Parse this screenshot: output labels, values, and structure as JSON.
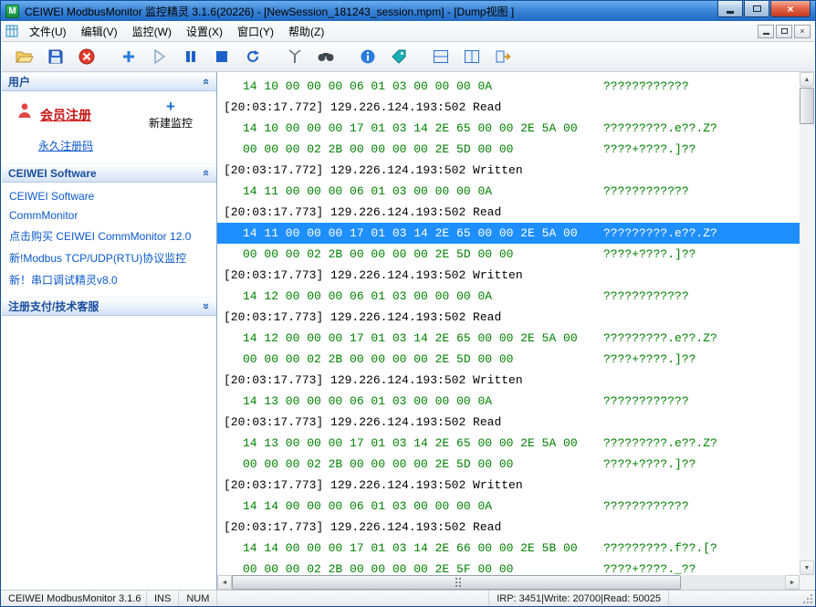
{
  "window": {
    "title": "CEIWEI ModbusMonitor 监控精灵 3.1.6(20226) - [NewSession_181243_session.mpm] - [Dump视图 ]",
    "icon_letter": "M"
  },
  "menu": {
    "items": [
      "文件(U)",
      "编辑(V)",
      "监控(W)",
      "设置(X)",
      "窗口(Y)",
      "帮助(Z)"
    ]
  },
  "toolbar": {
    "icons": [
      "open",
      "save",
      "cancel",
      "new-monitor",
      "start",
      "pause",
      "stop",
      "restart",
      "transmit",
      "find",
      "about",
      "tag",
      "split-horizontal",
      "split-vertical",
      "exit"
    ]
  },
  "sidebar": {
    "user": {
      "title": "用户",
      "member_register": "会员注册",
      "new_monitor": "新建监控",
      "permanent_code": "永久注册码"
    },
    "software": {
      "title": "CEIWEI Software",
      "links": [
        "CEIWEI Software",
        "CommMonitor",
        "点击购买 CEIWEI CommMonitor 12.0",
        "新!Modbus TCP/UDP(RTU)协议监控",
        "新！串口调试精灵v8.0"
      ]
    },
    "support": {
      "title": "注册支付/技术客服"
    }
  },
  "dump": {
    "lines": [
      {
        "type": "hex",
        "text": "14 10 00 00 00 06 01 03 00 00 00 0A",
        "ascii": "????????????"
      },
      {
        "type": "ts",
        "text": "[20:03:17.772] 129.226.124.193:502 Read"
      },
      {
        "type": "hex",
        "text": "14 10 00 00 00 17 01 03 14 2E 65 00 00 2E 5A 00",
        "ascii": "?????????.e??.Z?"
      },
      {
        "type": "hex",
        "text": "00 00 00 02 2B 00 00 00 00 2E 5D 00 00",
        "ascii": "????+????.]??"
      },
      {
        "type": "ts",
        "text": "[20:03:17.772] 129.226.124.193:502 Written"
      },
      {
        "type": "hex",
        "text": "14 11 00 00 00 06 01 03 00 00 00 0A",
        "ascii": "????????????"
      },
      {
        "type": "ts",
        "text": "[20:03:17.773] 129.226.124.193:502 Read"
      },
      {
        "type": "hex",
        "selected": true,
        "text": "14 11 00 00 00 17 01 03 14 2E 65 00 00 2E 5A 00",
        "ascii": "?????????.e??.Z?"
      },
      {
        "type": "hex",
        "text": "00 00 00 02 2B 00 00 00 00 2E 5D 00 00",
        "ascii": "????+????.]??"
      },
      {
        "type": "ts",
        "text": "[20:03:17.773] 129.226.124.193:502 Written"
      },
      {
        "type": "hex",
        "text": "14 12 00 00 00 06 01 03 00 00 00 0A",
        "ascii": "????????????"
      },
      {
        "type": "ts",
        "text": "[20:03:17.773] 129.226.124.193:502 Read"
      },
      {
        "type": "hex",
        "text": "14 12 00 00 00 17 01 03 14 2E 65 00 00 2E 5A 00",
        "ascii": "?????????.e??.Z?"
      },
      {
        "type": "hex",
        "text": "00 00 00 02 2B 00 00 00 00 2E 5D 00 00",
        "ascii": "????+????.]??"
      },
      {
        "type": "ts",
        "text": "[20:03:17.773] 129.226.124.193:502 Written"
      },
      {
        "type": "hex",
        "text": "14 13 00 00 00 06 01 03 00 00 00 0A",
        "ascii": "????????????"
      },
      {
        "type": "ts",
        "text": "[20:03:17.773] 129.226.124.193:502 Read"
      },
      {
        "type": "hex",
        "text": "14 13 00 00 00 17 01 03 14 2E 65 00 00 2E 5A 00",
        "ascii": "?????????.e??.Z?"
      },
      {
        "type": "hex",
        "text": "00 00 00 02 2B 00 00 00 00 2E 5D 00 00",
        "ascii": "????+????.]??"
      },
      {
        "type": "ts",
        "text": "[20:03:17.773] 129.226.124.193:502 Written"
      },
      {
        "type": "hex",
        "text": "14 14 00 00 00 06 01 03 00 00 00 0A",
        "ascii": "????????????"
      },
      {
        "type": "ts",
        "text": "[20:03:17.773] 129.226.124.193:502 Read"
      },
      {
        "type": "hex",
        "text": "14 14 00 00 00 17 01 03 14 2E 66 00 00 2E 5B 00",
        "ascii": "?????????.f??.[?"
      },
      {
        "type": "hex",
        "text": "00 00 00 02 2B 00 00 00 00 2E 5F 00 00",
        "ascii": "????+????._??"
      }
    ]
  },
  "statusbar": {
    "app_version": "CEIWEI ModbusMonitor 3.1.6",
    "ins": "INS",
    "num": "NUM",
    "counters": "IRP: 3451|Write: 20700|Read: 50025"
  },
  "colors": {
    "hex_text": "#008000",
    "timestamp_text": "#000000",
    "selection_bg": "#1e8fff",
    "link_blue": "#0a58cc",
    "register_red": "#c81414",
    "titlebar_blue": "#3d86d8"
  }
}
